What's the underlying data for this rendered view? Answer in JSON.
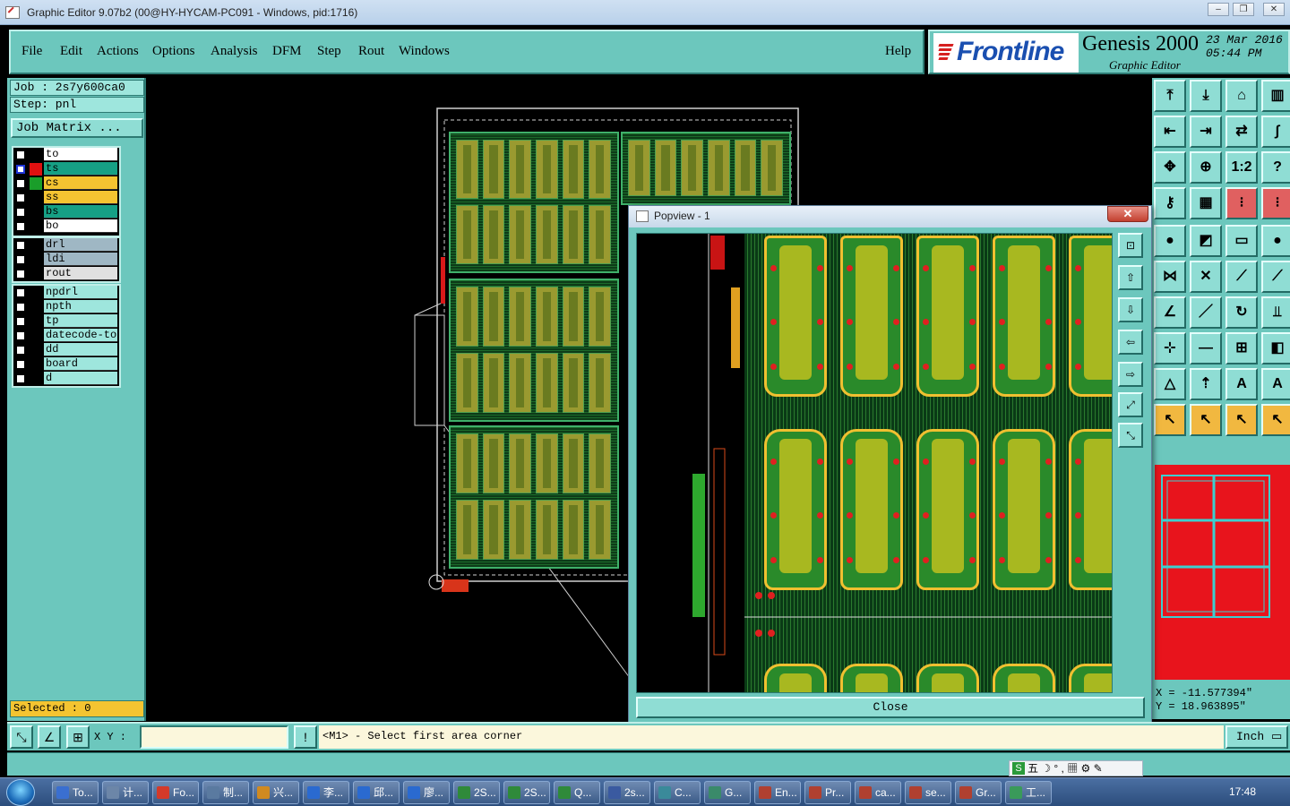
{
  "window": {
    "title": "Graphic Editor 9.07b2 (00@HY-HYCAM-PC091 - Windows, pid:1716)",
    "minimize": "▭",
    "maximize": "❐",
    "close": "✕"
  },
  "menu": {
    "items": [
      "File",
      "Edit",
      "Actions",
      "Options",
      "Analysis",
      "DFM",
      "Step",
      "Rout",
      "Windows"
    ],
    "help": "Help"
  },
  "brand": {
    "logo": "Frontline",
    "product": "Genesis 2000",
    "subtitle": "Graphic Editor",
    "date": "23 Mar 2016\n05:44 PM"
  },
  "job": {
    "job_label": "Job : 2s7y600ca0",
    "step_label": "Step: pnl",
    "matrix_button": "Job Matrix ..."
  },
  "layers": {
    "group1": [
      {
        "name": "to",
        "swatch": "#000000",
        "bg": "#ffffff",
        "blue": false
      },
      {
        "name": "ts",
        "swatch": "#e01010",
        "bg": "#16a085",
        "blue": true
      },
      {
        "name": "cs",
        "swatch": "#1a9e2a",
        "bg": "#f4c431",
        "blue": false
      },
      {
        "name": "ss",
        "swatch": "#000000",
        "bg": "#f4c431",
        "blue": false
      },
      {
        "name": "bs",
        "swatch": "#000000",
        "bg": "#16a085",
        "blue": false
      },
      {
        "name": "bo",
        "swatch": "#000000",
        "bg": "#ffffff",
        "blue": false
      }
    ],
    "group2": [
      {
        "name": "drl",
        "swatch": "#000000",
        "bg": "#9fb7c4"
      },
      {
        "name": "ldi",
        "swatch": "#000000",
        "bg": "#9fb7c4"
      },
      {
        "name": "rout",
        "swatch": "#000000",
        "bg": "#e0e0e0"
      }
    ],
    "group3": [
      {
        "name": "npdrl",
        "swatch": "#000000",
        "bg": "#9ee6dd"
      },
      {
        "name": "npth",
        "swatch": "#000000",
        "bg": "#9ee6dd"
      },
      {
        "name": "tp",
        "swatch": "#000000",
        "bg": "#9ee6dd"
      },
      {
        "name": "datecode-to",
        "swatch": "#000000",
        "bg": "#9ee6dd"
      },
      {
        "name": "dd",
        "swatch": "#000000",
        "bg": "#9ee6dd"
      },
      {
        "name": "board",
        "swatch": "#000000",
        "bg": "#9ee6dd"
      },
      {
        "name": "d",
        "swatch": "#000000",
        "bg": "#9ee6dd"
      }
    ]
  },
  "selected": "Selected : 0",
  "coords": {
    "x": "X = -11.577394\"",
    "y": "Y = 18.963895\""
  },
  "cmdbar": {
    "xy_label": "X Y :",
    "xy_value": "",
    "exclaim": "!",
    "prompt": "<M1> - Select first area corner",
    "unit": "Inch"
  },
  "popview": {
    "title": "Popview - 1",
    "close_x": "✕",
    "close_button": "Close",
    "tools": [
      "⊡",
      "⇧",
      "⇩",
      "⇦",
      "⇨",
      "⤢",
      "⤡"
    ]
  },
  "toolbar": {
    "rows": [
      [
        "upload-icon",
        "download-icon",
        "home-icon",
        "panel-icon"
      ],
      [
        "move-left-icon",
        "move-right-icon",
        "flip-icon",
        "s-shape-icon"
      ],
      [
        "fit-icon",
        "zoom-fit-icon",
        "scale-1to2-icon",
        "help-icon"
      ],
      [
        "key-icon",
        "grid-icon",
        "snap-icon",
        "snap2-icon"
      ],
      [
        "pad-icon",
        "fill-icon",
        "ruler-icon",
        "dot-icon"
      ],
      [
        "connect-icon",
        "cross-icon",
        "line-node-icon",
        "line-end-icon"
      ],
      [
        "angle-icon",
        "slash-icon",
        "arc-icon",
        "brace-icon"
      ],
      [
        "node-add-icon",
        "dash-icon",
        "box-icon",
        "overlap-icon"
      ],
      [
        "triangle-icon",
        "arrow-up-icon",
        "letter-a-icon",
        "letter-a2-icon"
      ],
      [
        "pointer-icon",
        "select-icon",
        "select2-icon",
        "multi-select-icon"
      ]
    ],
    "glyphs": [
      [
        "⤒",
        "⤓",
        "⌂",
        "▥"
      ],
      [
        "⇤",
        "⇥",
        "⇄",
        "∫"
      ],
      [
        "✥",
        "⊕",
        "1:2",
        "?"
      ],
      [
        "⚷",
        "▦",
        "⁝",
        "⁝"
      ],
      [
        "●",
        "◩",
        "▭",
        "●"
      ],
      [
        "⋈",
        "✕",
        "⟋",
        "⟋"
      ],
      [
        "∠",
        "／",
        "↻",
        "⫫"
      ],
      [
        "⊹",
        "—",
        "⊞",
        "◧"
      ],
      [
        "△",
        "⇡",
        "A",
        "A"
      ],
      [
        "↖",
        "↖",
        "↖",
        "↖"
      ]
    ]
  },
  "ime": "五 ☽ ° , ▦ ⚙ ✎",
  "taskbar": {
    "items": [
      "To...",
      "计...",
      "Fo...",
      "制...",
      "兴...",
      "李...",
      "邱...",
      "廖...",
      "2S...",
      "2S...",
      "Q...",
      "2s...",
      "C...",
      "G...",
      "En...",
      "Pr...",
      "ca...",
      "se...",
      "Gr...",
      "工..."
    ],
    "clock": "17:48"
  }
}
